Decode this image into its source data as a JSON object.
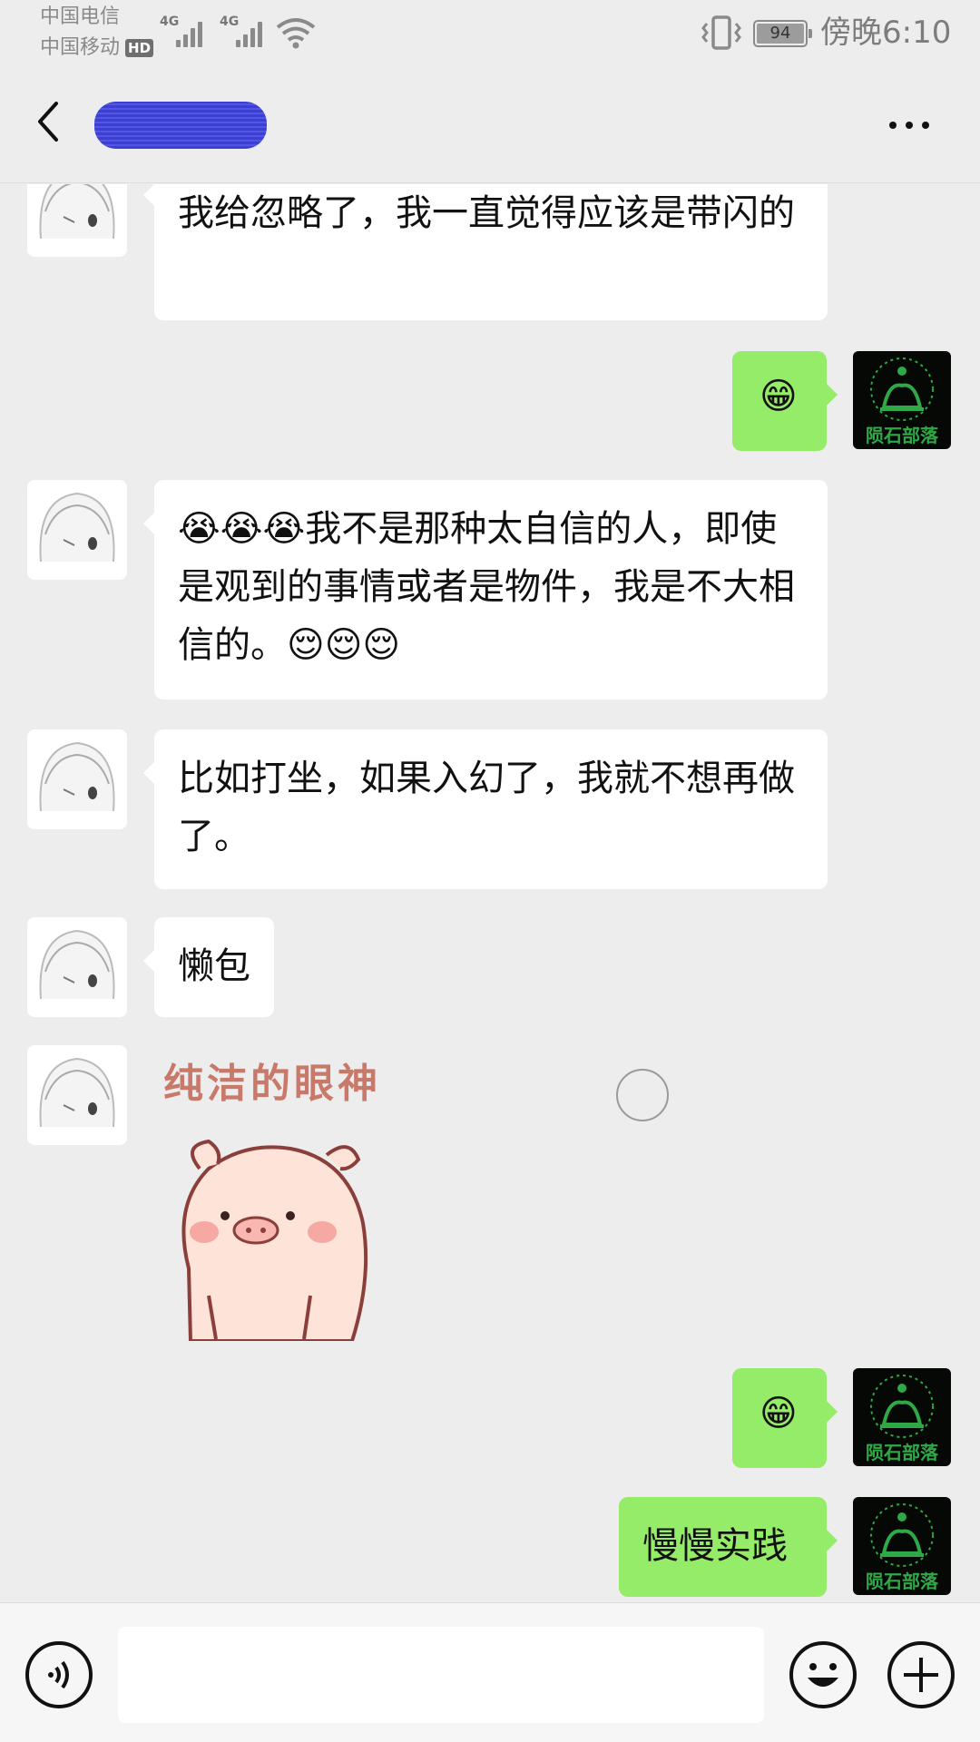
{
  "status_bar": {
    "carrier_1": "中国电信",
    "carrier_2": "中国移动",
    "hd_badge": "HD",
    "signal_1_label": "4G",
    "signal_2_label": "4G",
    "battery": "94",
    "time": "傍晚6:10"
  },
  "header": {
    "title": "",
    "back_icon": "chevron-left-icon",
    "more_icon": "more-dots-icon"
  },
  "messages": [
    {
      "from": "other",
      "text": "我给忽略了，我一直觉得应该是带闪的"
    },
    {
      "from": "me",
      "text": "😁"
    },
    {
      "from": "other",
      "emoji_before": "😭",
      "text_a": "我不是那种太自信的人，即使是观到的事情或者是物件，我是不大相信的。",
      "emoji_after": "😌"
    },
    {
      "from": "other",
      "text": "比如打坐，如果入幻了，我就不想再做了。"
    },
    {
      "from": "other",
      "text": "懒包"
    },
    {
      "from": "other",
      "sticker_text": "纯洁的眼神"
    },
    {
      "from": "me",
      "text": "😁"
    },
    {
      "from": "me",
      "text": "慢慢实践"
    }
  ],
  "avatar_me_caption": "陨石部落",
  "input_bar": {
    "voice_icon": "voice-icon",
    "emoji_icon": "emoji-icon",
    "plus_icon": "plus-icon",
    "placeholder": ""
  },
  "colors": {
    "background": "#ededed",
    "bubble_me": "#95ec69",
    "bubble_other": "#ffffff",
    "avatar_me_green": "#2fa846"
  }
}
